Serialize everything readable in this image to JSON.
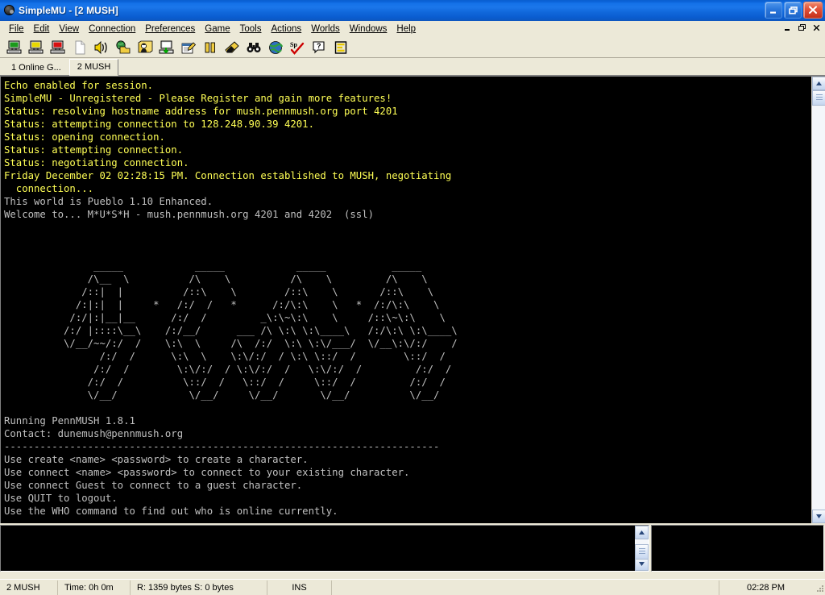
{
  "window": {
    "title": "SimpleMU - [2 MUSH]",
    "app_icon": "globe-icon",
    "buttons": {
      "minimize": "minimize-icon",
      "restore": "restore-icon",
      "close": "close-icon"
    }
  },
  "menubar": {
    "items": [
      {
        "label": "File",
        "accel": "F"
      },
      {
        "label": "Edit",
        "accel": "E"
      },
      {
        "label": "View",
        "accel": "V"
      },
      {
        "label": "Connection",
        "accel": "C"
      },
      {
        "label": "Preferences",
        "accel": "n"
      },
      {
        "label": "Game",
        "accel": "G"
      },
      {
        "label": "Tools",
        "accel": "T"
      },
      {
        "label": "Actions",
        "accel": "i"
      },
      {
        "label": "Worlds",
        "accel": "r"
      },
      {
        "label": "Windows",
        "accel": "i"
      },
      {
        "label": "Help",
        "accel": "H"
      }
    ],
    "mdi_buttons": [
      "mdi-minimize-icon",
      "mdi-restore-icon",
      "mdi-close-icon"
    ]
  },
  "toolbar": {
    "buttons": [
      {
        "name": "connect-world-icon",
        "tip": "Connect"
      },
      {
        "name": "disconnect-world-icon",
        "tip": "Disconnect"
      },
      {
        "name": "close-world-icon",
        "tip": "Close World"
      },
      {
        "name": "new-document-icon",
        "tip": "New"
      },
      {
        "name": "sound-icon",
        "tip": "Sound"
      },
      {
        "name": "open-folder-world-icon",
        "tip": "Open World"
      },
      {
        "name": "character-icon",
        "tip": "Character"
      },
      {
        "name": "download-icon",
        "tip": "Download"
      },
      {
        "name": "edit-notes-icon",
        "tip": "Notes"
      },
      {
        "name": "pause-icon",
        "tip": "Pause"
      },
      {
        "name": "highlighter-icon",
        "tip": "Highlight"
      },
      {
        "name": "binoculars-icon",
        "tip": "Find"
      },
      {
        "name": "globe-icon",
        "tip": "Web"
      },
      {
        "name": "spellcheck-icon",
        "tip": "Spell Check"
      },
      {
        "name": "help-icon",
        "tip": "Help"
      },
      {
        "name": "editor-icon",
        "tip": "Editor"
      }
    ]
  },
  "tabs": [
    {
      "label": "1 Online G...",
      "active": false
    },
    {
      "label": "2 MUSH",
      "active": true
    }
  ],
  "console": {
    "lines": [
      {
        "color": "yellow",
        "text": "Echo enabled for session."
      },
      {
        "color": "yellow",
        "text": "SimpleMU - Unregistered - Please Register and gain more features!"
      },
      {
        "color": "yellow",
        "text": "Status: resolving hostname address for mush.pennmush.org port 4201"
      },
      {
        "color": "yellow",
        "text": "Status: attempting connection to 128.248.90.39 4201."
      },
      {
        "color": "yellow",
        "text": "Status: opening connection."
      },
      {
        "color": "yellow",
        "text": "Status: attempting connection."
      },
      {
        "color": "yellow",
        "text": "Status: negotiating connection."
      },
      {
        "color": "yellow",
        "text": "Friday December 02 02:28:15 PM. Connection established to MUSH, negotiating"
      },
      {
        "color": "yellow",
        "text": "  connection..."
      },
      {
        "color": "grey",
        "text": "This world is Pueblo 1.10 Enhanced."
      },
      {
        "color": "grey",
        "text": "Welcome to... M*U*S*H - mush.pennmush.org 4201 and 4202  (ssl)"
      },
      {
        "color": "grey",
        "text": ""
      },
      {
        "color": "grey",
        "text": ""
      },
      {
        "color": "grey",
        "text": ""
      },
      {
        "color": "grey",
        "text": "               _____            _____            _____           _____"
      },
      {
        "color": "grey",
        "text": "              /\\__  \\          /\\    \\          /\\    \\         /\\    \\"
      },
      {
        "color": "grey",
        "text": "             /::|  |          /::\\    \\        /::\\    \\       /::\\    \\"
      },
      {
        "color": "grey",
        "text": "            /:|:|  |     *   /:/  /   *      /:/\\:\\    \\   *  /:/\\:\\    \\"
      },
      {
        "color": "grey",
        "text": "           /:/|:|__|__      /:/  /         _\\:\\~\\:\\    \\     /::\\~\\:\\    \\"
      },
      {
        "color": "grey",
        "text": "          /:/ |::::\\__\\    /:/__/      ___ /\\ \\:\\ \\:\\____\\   /:/\\:\\ \\:\\____\\"
      },
      {
        "color": "grey",
        "text": "          \\/__/~~/:/  /    \\:\\  \\     /\\  /:/  \\:\\ \\:\\/___/  \\/__\\:\\/:/    /"
      },
      {
        "color": "grey",
        "text": "                /:/  /      \\:\\  \\    \\:\\/:/  / \\:\\ \\::/  /        \\::/  /"
      },
      {
        "color": "grey",
        "text": "               /:/  /        \\:\\/:/  / \\:\\/:/  /   \\:\\/:/  /         /:/  /"
      },
      {
        "color": "grey",
        "text": "              /:/  /          \\::/  /   \\::/  /     \\::/  /         /:/  /"
      },
      {
        "color": "grey",
        "text": "              \\/__/            \\/__/     \\/__/       \\/__/          \\/__/"
      },
      {
        "color": "grey",
        "text": ""
      },
      {
        "color": "grey",
        "text": "Running PennMUSH 1.8.1"
      },
      {
        "color": "grey",
        "text": "Contact: dunemush@pennmush.org"
      },
      {
        "color": "grey",
        "text": "-------------------------------------------------------------------------"
      },
      {
        "color": "grey",
        "text": "Use create <name> <password> to create a character."
      },
      {
        "color": "grey",
        "text": "Use connect <name> <password> to connect to your existing character."
      },
      {
        "color": "grey",
        "text": "Use connect Guest to connect to a guest character."
      },
      {
        "color": "grey",
        "text": "Use QUIT to logout."
      },
      {
        "color": "grey",
        "text": "Use the WHO command to find out who is online currently."
      },
      {
        "color": "grey",
        "text": "-------------------------------------------------------------------------"
      }
    ]
  },
  "input": {
    "command_value": "",
    "side_panel_value": ""
  },
  "statusbar": {
    "world": "2 MUSH",
    "time": "Time: 0h 0m",
    "bytes": "R: 1359 bytes S: 0 bytes",
    "insert_mode": "INS",
    "spacer": "",
    "clock": "02:28 PM"
  },
  "colors": {
    "titlebar_blue": "#1472e8",
    "chrome": "#ece9d8",
    "terminal_bg": "#000000",
    "terminal_yellow": "#ffff55",
    "terminal_grey": "#c0c0c0",
    "close_red": "#e2523a"
  }
}
